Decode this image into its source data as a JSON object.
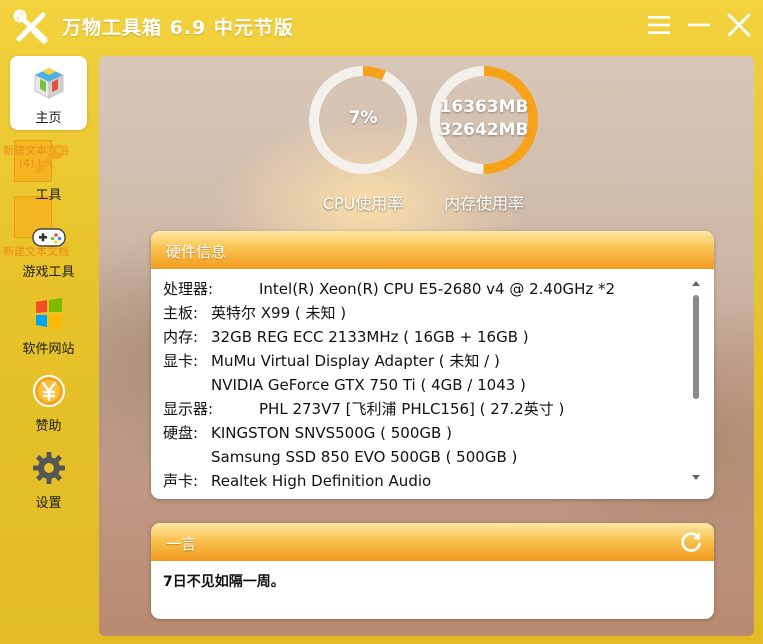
{
  "window": {
    "title": "万物工具箱 6.9 中元节版"
  },
  "titlebar_buttons": [
    "menu-icon",
    "minimize-icon",
    "close-icon"
  ],
  "sidebar": {
    "items": [
      {
        "label": "主页",
        "icon": "home-cube-icon",
        "active": true
      },
      {
        "label": "工具",
        "icon": "wrench-icon",
        "active": false
      },
      {
        "label": "游戏工具",
        "icon": "gamepad-icon",
        "active": false
      },
      {
        "label": "软件网站",
        "icon": "windows-icon",
        "active": false
      },
      {
        "label": "赞助",
        "icon": "yen-coin-icon",
        "active": false
      },
      {
        "label": "设置",
        "icon": "gear-icon",
        "active": false
      }
    ],
    "desktop_files": [
      {
        "label_line1": "新建文本文档",
        "label_line2": "(4).txt"
      },
      {
        "label_line1": "新建文本文档",
        "label_line2": ""
      }
    ]
  },
  "gauges": {
    "cpu": {
      "value_text": "7%",
      "fraction": 0.07,
      "caption": "CPU使用率"
    },
    "memory": {
      "used": "16363MB",
      "total": "32642MB",
      "fraction": 0.501,
      "caption": "内存使用率"
    }
  },
  "hardware": {
    "title": "硬件信息",
    "rows": [
      {
        "label": "处理器:",
        "value": "Intel(R) Xeon(R) CPU E5-2680 v4 @ 2.40GHz *2"
      },
      {
        "label": "主板:",
        "value": "英特尔 X99 ( 未知 )"
      },
      {
        "label": "内存:",
        "value": "32GB REG ECC 2133MHz ( 16GB + 16GB )"
      },
      {
        "label": "显卡:",
        "value": "MuMu Virtual Display Adapter ( 未知 / )"
      },
      {
        "label": "",
        "value": "NVIDIA GeForce GTX 750 Ti ( 4GB / 1043 )"
      },
      {
        "label": "显示器:",
        "value": "PHL 273V7 [飞利浦 PHLC156] ( 27.2英寸 )"
      },
      {
        "label": "硬盘:",
        "value": "KINGSTON SNVS500G ( 500GB )"
      },
      {
        "label": "",
        "value": "Samsung SSD 850 EVO 500GB ( 500GB )"
      },
      {
        "label": "声卡:",
        "value": "Realtek High Definition Audio"
      }
    ]
  },
  "quote": {
    "title": "一言",
    "text": "7日不见如隔一周。"
  },
  "colors": {
    "accent_yellow": "#e8c32a",
    "gauge_orange": "#f7a21b",
    "panel_orange": "#f29a1f"
  }
}
